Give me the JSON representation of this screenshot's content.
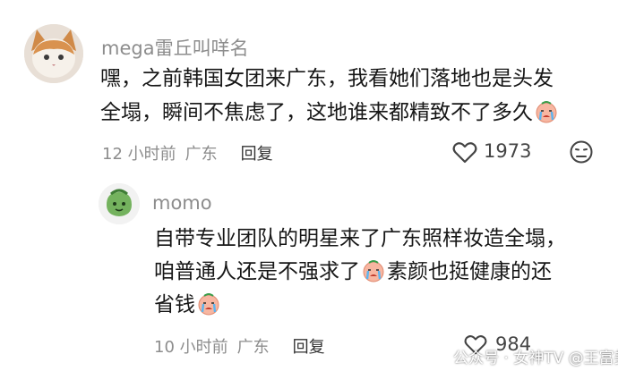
{
  "comments": [
    {
      "username": "mega雷丘叫咩名",
      "lines": [
        "嘿，之前韩国女团来广东，我看她们落地也是头发",
        "全塌，瞬间不焦虑了，这地谁来都精致不了多久"
      ],
      "time": "12 小时前",
      "location": "广东",
      "reply_label": "回复",
      "like_count": "1973"
    },
    {
      "username": "momo",
      "lines": [
        "自带专业团队的明星来了广东照样妆造全塌，",
        "咱普通人还是不强求了",
        "素颜也挺健康的还",
        "省钱"
      ],
      "time": "10 小时前",
      "location": "广东",
      "reply_label": "回复",
      "like_count": "984"
    }
  ],
  "watermark": "公众号 · 女神TV  @王富美娘",
  "icons": {
    "like": "heart-outline-icon",
    "dislike": "unhappy-face-icon",
    "emoji": "crying-emoji-icon"
  }
}
